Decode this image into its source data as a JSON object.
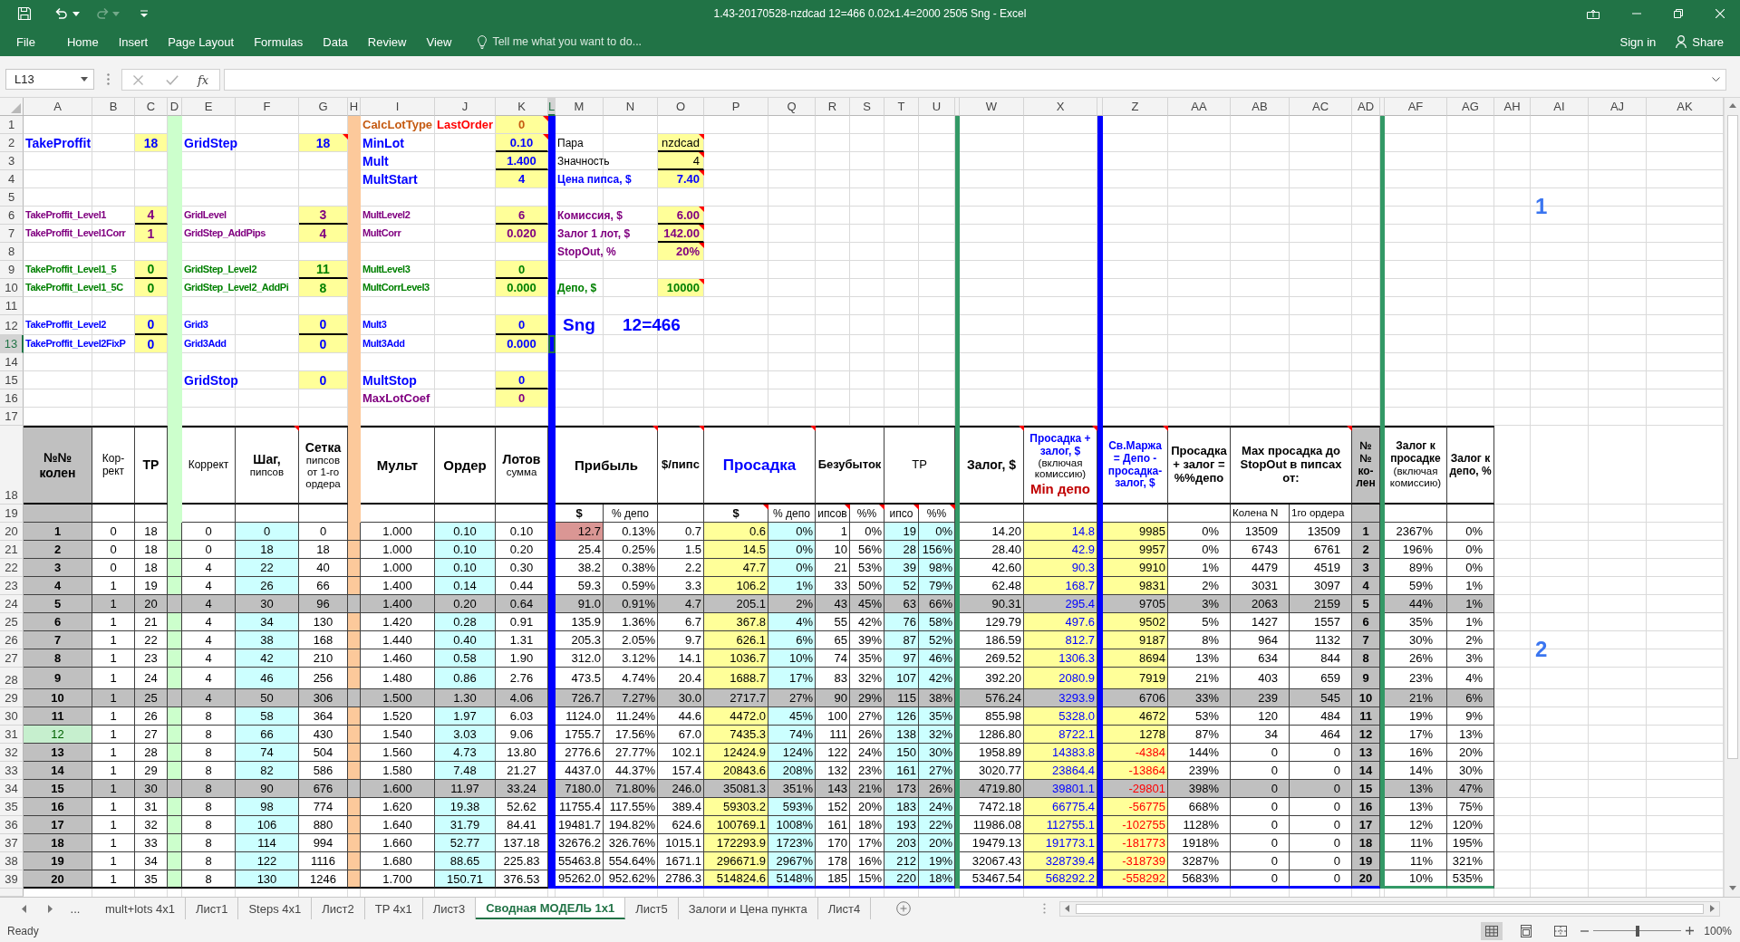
{
  "window": {
    "title": "1.43-20170528-nzdcad 12=466 0.02x1.4=2000 2505 Sng - Excel"
  },
  "quick_access": {
    "redo_disabled": true
  },
  "ribbon": {
    "tabs": [
      {
        "label": "File",
        "selected": false
      },
      {
        "label": "Home",
        "selected": false
      },
      {
        "label": "Insert",
        "selected": false
      },
      {
        "label": "Page Layout",
        "selected": false
      },
      {
        "label": "Formulas",
        "selected": false
      },
      {
        "label": "Data",
        "selected": false
      },
      {
        "label": "Review",
        "selected": false
      },
      {
        "label": "View",
        "selected": false
      }
    ],
    "tell_me": {
      "placeholder": "Tell me what you want to do..."
    },
    "sign_in": "Sign in",
    "share": "Share"
  },
  "formula_bar": {
    "name_box": "L13",
    "function_label": "fx",
    "edit_disabled": true
  },
  "columns": [
    {
      "label": "A",
      "selected": false
    },
    {
      "label": "B",
      "selected": false
    },
    {
      "label": "C",
      "selected": false
    },
    {
      "label": "D",
      "selected": false
    },
    {
      "label": "E",
      "selected": false
    },
    {
      "label": "F",
      "selected": false
    },
    {
      "label": "G",
      "selected": false
    },
    {
      "label": "H",
      "selected": false
    },
    {
      "label": "I",
      "selected": false
    },
    {
      "label": "J",
      "selected": false
    },
    {
      "label": "K",
      "selected": false
    },
    {
      "label": "L",
      "selected": true
    },
    {
      "label": "M",
      "selected": false
    },
    {
      "label": "N",
      "selected": false
    },
    {
      "label": "O",
      "selected": false
    },
    {
      "label": "P",
      "selected": false
    },
    {
      "label": "Q",
      "selected": false
    },
    {
      "label": "R",
      "selected": false
    },
    {
      "label": "S",
      "selected": false
    },
    {
      "label": "T",
      "selected": false
    },
    {
      "label": "U",
      "selected": false
    },
    {
      "selected": false
    },
    {
      "label": "W",
      "selected": false
    },
    {
      "label": "X",
      "selected": false
    },
    {
      "selected": false
    },
    {
      "label": "Z",
      "selected": false
    },
    {
      "label": "AA",
      "selected": false
    },
    {
      "label": "AB",
      "selected": false
    },
    {
      "label": "AC",
      "selected": false
    },
    {
      "label": "AD",
      "selected": false
    },
    {
      "selected": false
    },
    {
      "label": "AF",
      "selected": false
    },
    {
      "label": "AG",
      "selected": false
    },
    {
      "label": "AH",
      "selected": false
    },
    {
      "label": "AI",
      "selected": false
    },
    {
      "label": "AJ",
      "selected": false
    },
    {
      "label": "AK",
      "selected": false
    }
  ],
  "rows": [
    {
      "label": "1",
      "selected": false
    },
    {
      "label": "2",
      "selected": false
    },
    {
      "label": "3",
      "selected": false
    },
    {
      "label": "4",
      "selected": false
    },
    {
      "label": "5",
      "selected": false
    },
    {
      "label": "6",
      "selected": false
    },
    {
      "label": "7",
      "selected": false
    },
    {
      "label": "8",
      "selected": false
    },
    {
      "label": "9",
      "selected": false
    },
    {
      "label": "10",
      "selected": false
    },
    {
      "label": "11",
      "selected": false
    },
    {
      "label": "12",
      "selected": false
    },
    {
      "label": "13",
      "selected": true
    },
    {
      "label": "14",
      "selected": false
    },
    {
      "label": "15",
      "selected": false
    },
    {
      "label": "16",
      "selected": false
    },
    {
      "label": "17",
      "selected": false
    },
    {
      "label": "18",
      "selected": false
    },
    {
      "label": "19",
      "selected": false
    },
    {
      "label": "20",
      "selected": false
    },
    {
      "label": "21",
      "selected": false
    },
    {
      "label": "22",
      "selected": false
    },
    {
      "label": "23",
      "selected": false
    },
    {
      "label": "24",
      "selected": false
    },
    {
      "label": "25",
      "selected": false
    },
    {
      "label": "26",
      "selected": false
    },
    {
      "label": "27",
      "selected": false
    },
    {
      "label": "28",
      "selected": false
    },
    {
      "label": "29",
      "selected": false
    },
    {
      "label": "30",
      "selected": false
    },
    {
      "label": "31",
      "selected": false
    },
    {
      "label": "32",
      "selected": false
    },
    {
      "label": "33",
      "selected": false
    },
    {
      "label": "34",
      "selected": false
    },
    {
      "label": "35",
      "selected": false
    },
    {
      "label": "36",
      "selected": false
    },
    {
      "label": "37",
      "selected": false
    },
    {
      "label": "38",
      "selected": false
    },
    {
      "label": "39",
      "selected": false
    }
  ],
  "parameters": {
    "take_profit": [
      {
        "label": "TakeProffit",
        "value": "18",
        "kind": "main",
        "ruled": false,
        "comment": false
      },
      {
        "label": "TakeProffit_Level1",
        "value": "4",
        "kind": "level1",
        "ruled": true,
        "comment": false
      },
      {
        "label": "TakeProffit_Level1Corr",
        "value": "1",
        "kind": "level1",
        "ruled": false,
        "comment": false
      },
      {
        "label": "TakeProffit_Level1_5",
        "value": "0",
        "kind": "level15",
        "ruled": true,
        "comment": false
      },
      {
        "label": "TakeProffit_Level1_5C",
        "value": "0",
        "kind": "level15",
        "ruled": false,
        "comment": false
      },
      {
        "label": "TakeProffit_Level2",
        "value": "0",
        "kind": "level2",
        "ruled": true,
        "comment": false
      },
      {
        "label": "TakeProffit_Level2FixP",
        "value": "0",
        "kind": "level2",
        "ruled": false,
        "comment": false
      }
    ],
    "grid": [
      {
        "label": "GridStep",
        "value": "18",
        "kind": "main",
        "ruled": false,
        "comment": true
      },
      {
        "label": "GridLevel",
        "value": "3",
        "kind": "level1",
        "ruled": true,
        "comment": false
      },
      {
        "label": "GridStep_AddPips",
        "value": "4",
        "kind": "level1",
        "ruled": false,
        "comment": false
      },
      {
        "label": "GridStep_Level2",
        "value": "11",
        "kind": "level15",
        "ruled": true,
        "comment": false
      },
      {
        "label": "GridStep_Level2_AddPi",
        "value": "8",
        "kind": "level15",
        "ruled": false,
        "comment": false
      },
      {
        "label": "Grid3",
        "value": "0",
        "kind": "level2",
        "ruled": true,
        "comment": false
      },
      {
        "label": "Grid3Add",
        "value": "0",
        "kind": "level2",
        "ruled": false,
        "comment": false
      },
      {
        "label": "GridStop",
        "value": "0",
        "kind": "main",
        "ruled": false,
        "comment": false
      }
    ],
    "lots": [
      {
        "label": "CalcLotType",
        "mode": "LastOrder",
        "value": "0",
        "kind": "type",
        "ruled": false,
        "comment": true
      },
      {
        "label": "MinLot",
        "value": "0.10",
        "kind": "main",
        "ruled": true,
        "comment": true
      },
      {
        "label": "Mult",
        "value": "1.400",
        "kind": "main",
        "ruled": true,
        "comment": false
      },
      {
        "label": "MultStart",
        "value": "4",
        "kind": "main",
        "ruled": false,
        "comment": false
      },
      {
        "label": "MultLevel2",
        "value": "6",
        "kind": "level1",
        "ruled": true,
        "comment": false
      },
      {
        "label": "MultCorr",
        "value": "0.020",
        "kind": "level1",
        "ruled": false,
        "comment": false
      },
      {
        "label": "MultLevel3",
        "value": "0",
        "kind": "level15",
        "ruled": true,
        "comment": false
      },
      {
        "label": "MultCorrLevel3",
        "value": "0.000",
        "kind": "level15",
        "ruled": false,
        "comment": false
      },
      {
        "label": "Mult3",
        "value": "0",
        "kind": "level2",
        "ruled": true,
        "comment": false
      },
      {
        "label": "Mult3Add",
        "value": "0.000",
        "kind": "level2",
        "ruled": false,
        "comment": false
      },
      {
        "label": "MultStop",
        "value": "0",
        "kind": "main",
        "ruled": true,
        "comment": false
      },
      {
        "label": "MaxLotCoef",
        "value": "0",
        "kind": "limit",
        "ruled": false,
        "comment": false
      }
    ],
    "instrument": [
      {
        "label": "Пара",
        "value": "nzdcad",
        "kind": "plain",
        "ruled": true,
        "comment": true
      },
      {
        "label": "Значность",
        "value": "4",
        "kind": "plain",
        "ruled": true,
        "comment": true
      },
      {
        "label": "Цена пипса, $",
        "value": "7.40",
        "kind": "main",
        "ruled": false,
        "comment": true
      },
      {
        "label": "Комиссия, $",
        "value": "6.00",
        "kind": "level1",
        "ruled": true,
        "comment": true
      },
      {
        "label": "Залог 1 лот, $",
        "value": "142.00",
        "kind": "level1",
        "ruled": true,
        "comment": true
      },
      {
        "label": "StopOut, %",
        "value": "20%",
        "kind": "level1",
        "ruled": false,
        "comment": true
      },
      {
        "label": "Депо, $",
        "value": "10000",
        "kind": "level15",
        "ruled": false,
        "comment": true
      }
    ]
  },
  "notes": [
    "Sng",
    "12=466"
  ],
  "markers": [
    "1",
    "2"
  ],
  "table": {
    "headers": [
      {
        "text": "№№ колен",
        "comment": false
      },
      {
        "text": "Кор-рект",
        "comment": false
      },
      {
        "text": "TP",
        "comment": false
      },
      {
        "text": "Коррект",
        "comment": false
      },
      {
        "text": "**Шаг,** пипсов",
        "comment": true
      },
      {
        "text": "**Сетка** пипсов от 1-го ордера",
        "comment": false
      },
      {
        "text": "Мульт",
        "comment": false
      },
      {
        "text": "Ордер",
        "comment": false
      },
      {
        "text": "**Лотов** сумма",
        "comment": false
      },
      {
        "text": "Прибыль",
        "comment": true
      },
      {
        "text": "$/пипс",
        "comment": true
      },
      {
        "text": "Просадка",
        "comment": true
      },
      {
        "text": "Безубыток",
        "comment": false
      },
      {
        "text": "TP",
        "comment": false
      },
      {
        "text": "Залог, $",
        "comment": true
      },
      {
        "text": "**Просадка + залог, $** (включая комиссию)",
        "warning": "Min депо",
        "comment": true
      },
      {
        "text": "Св.Маржа = Депо - просадка-залог, $",
        "comment": true
      },
      {
        "text": "Просадка + залог = %%депо",
        "comment": false
      },
      {
        "text": "Max просадка до StopOut в пипсах от:",
        "comment": true
      },
      {
        "text": "№ № ко-лен",
        "comment": false
      },
      {
        "text": "**Залог к просадке** (включая комиссию)",
        "comment": false
      },
      {
        "text": "Залог к депо, %",
        "comment": false
      }
    ],
    "subheaders": [
      {
        "text": "$",
        "comment": false
      },
      {
        "text": "% депо",
        "comment": false
      },
      {
        "text": "$",
        "comment": true
      },
      {
        "text": "% депо",
        "comment": false
      },
      {
        "text": "ипсов",
        "comment": true
      },
      {
        "text": "%%",
        "comment": true
      },
      {
        "text": "ипсо",
        "comment": true
      },
      {
        "text": "%%",
        "comment": true
      },
      {
        "text": "Колена N",
        "comment": false
      },
      {
        "text": "1го ордера",
        "comment": false
      }
    ],
    "rows": [
      {
        "cells": [
          "1",
          "0",
          "18",
          "0",
          "0",
          "0",
          "1.000",
          "0.10",
          "0.10",
          "12.7",
          "0.13%",
          "0.7",
          "0.6",
          "0%",
          "1",
          "0%",
          "19",
          "0%",
          "14.20",
          "14.8",
          "9985",
          "0%",
          "13509",
          "13509",
          "1",
          "2367%",
          "0%"
        ],
        "highlighted": false,
        "knee_marked": false,
        "profit_alert": true,
        "free_margin_negative": false
      },
      {
        "cells": [
          "2",
          "0",
          "18",
          "0",
          "18",
          "18",
          "1.000",
          "0.10",
          "0.20",
          "25.4",
          "0.25%",
          "1.5",
          "14.5",
          "0%",
          "10",
          "56%",
          "28",
          "156%",
          "28.40",
          "42.9",
          "9957",
          "0%",
          "6743",
          "6761",
          "2",
          "196%",
          "0%"
        ],
        "highlighted": false,
        "knee_marked": false,
        "profit_alert": false,
        "free_margin_negative": false
      },
      {
        "cells": [
          "3",
          "0",
          "18",
          "4",
          "22",
          "40",
          "1.000",
          "0.10",
          "0.30",
          "38.2",
          "0.38%",
          "2.2",
          "47.7",
          "0%",
          "21",
          "53%",
          "39",
          "98%",
          "42.60",
          "90.3",
          "9910",
          "1%",
          "4479",
          "4519",
          "3",
          "89%",
          "0%"
        ],
        "highlighted": false,
        "knee_marked": false,
        "profit_alert": false,
        "free_margin_negative": false
      },
      {
        "cells": [
          "4",
          "1",
          "19",
          "4",
          "26",
          "66",
          "1.400",
          "0.14",
          "0.44",
          "59.3",
          "0.59%",
          "3.3",
          "106.2",
          "1%",
          "33",
          "50%",
          "52",
          "79%",
          "62.48",
          "168.7",
          "9831",
          "2%",
          "3031",
          "3097",
          "4",
          "59%",
          "1%"
        ],
        "highlighted": false,
        "knee_marked": false,
        "profit_alert": false,
        "free_margin_negative": false
      },
      {
        "cells": [
          "5",
          "1",
          "20",
          "4",
          "30",
          "96",
          "1.400",
          "0.20",
          "0.64",
          "91.0",
          "0.91%",
          "4.7",
          "205.1",
          "2%",
          "43",
          "45%",
          "63",
          "66%",
          "90.31",
          "295.4",
          "9705",
          "3%",
          "2063",
          "2159",
          "5",
          "44%",
          "1%"
        ],
        "highlighted": true,
        "knee_marked": false,
        "profit_alert": false,
        "free_margin_negative": false
      },
      {
        "cells": [
          "6",
          "1",
          "21",
          "4",
          "34",
          "130",
          "1.420",
          "0.28",
          "0.91",
          "135.9",
          "1.36%",
          "6.7",
          "367.8",
          "4%",
          "55",
          "42%",
          "76",
          "58%",
          "129.79",
          "497.6",
          "9502",
          "5%",
          "1427",
          "1557",
          "6",
          "35%",
          "1%"
        ],
        "highlighted": false,
        "knee_marked": false,
        "profit_alert": false,
        "free_margin_negative": false
      },
      {
        "cells": [
          "7",
          "1",
          "22",
          "4",
          "38",
          "168",
          "1.440",
          "0.40",
          "1.31",
          "205.3",
          "2.05%",
          "9.7",
          "626.1",
          "6%",
          "65",
          "39%",
          "87",
          "52%",
          "186.59",
          "812.7",
          "9187",
          "8%",
          "964",
          "1132",
          "7",
          "30%",
          "2%"
        ],
        "highlighted": false,
        "knee_marked": false,
        "profit_alert": false,
        "free_margin_negative": false
      },
      {
        "cells": [
          "8",
          "1",
          "23",
          "4",
          "42",
          "210",
          "1.460",
          "0.58",
          "1.90",
          "312.0",
          "3.12%",
          "14.1",
          "1036.7",
          "10%",
          "74",
          "35%",
          "97",
          "46%",
          "269.52",
          "1306.3",
          "8694",
          "13%",
          "634",
          "844",
          "8",
          "26%",
          "3%"
        ],
        "highlighted": false,
        "knee_marked": false,
        "profit_alert": false,
        "free_margin_negative": false
      },
      {
        "cells": [
          "9",
          "1",
          "24",
          "4",
          "46",
          "256",
          "1.480",
          "0.86",
          "2.76",
          "473.5",
          "4.74%",
          "20.4",
          "1688.7",
          "17%",
          "83",
          "32%",
          "107",
          "42%",
          "392.20",
          "2080.9",
          "7919",
          "21%",
          "403",
          "659",
          "9",
          "23%",
          "4%"
        ],
        "highlighted": false,
        "knee_marked": false,
        "profit_alert": false,
        "free_margin_negative": false
      },
      {
        "cells": [
          "10",
          "1",
          "25",
          "4",
          "50",
          "306",
          "1.500",
          "1.30",
          "4.06",
          "726.7",
          "7.27%",
          "30.0",
          "2717.7",
          "27%",
          "90",
          "29%",
          "115",
          "38%",
          "576.24",
          "3293.9",
          "6706",
          "33%",
          "239",
          "545",
          "10",
          "21%",
          "6%"
        ],
        "highlighted": true,
        "knee_marked": false,
        "profit_alert": false,
        "free_margin_negative": false
      },
      {
        "cells": [
          "11",
          "1",
          "26",
          "8",
          "58",
          "364",
          "1.520",
          "1.97",
          "6.03",
          "1124.0",
          "11.24%",
          "44.6",
          "4472.0",
          "45%",
          "100",
          "27%",
          "126",
          "35%",
          "855.98",
          "5328.0",
          "4672",
          "53%",
          "120",
          "484",
          "11",
          "19%",
          "9%"
        ],
        "highlighted": false,
        "knee_marked": false,
        "profit_alert": false,
        "free_margin_negative": false
      },
      {
        "cells": [
          "12",
          "1",
          "27",
          "8",
          "66",
          "430",
          "1.540",
          "3.03",
          "9.06",
          "1755.7",
          "17.56%",
          "67.0",
          "7435.3",
          "74%",
          "111",
          "26%",
          "138",
          "32%",
          "1286.80",
          "8722.1",
          "1278",
          "87%",
          "34",
          "464",
          "12",
          "17%",
          "13%"
        ],
        "highlighted": false,
        "knee_marked": true,
        "profit_alert": false,
        "free_margin_negative": false
      },
      {
        "cells": [
          "13",
          "1",
          "28",
          "8",
          "74",
          "504",
          "1.560",
          "4.73",
          "13.80",
          "2776.6",
          "27.77%",
          "102.1",
          "12424.9",
          "124%",
          "122",
          "24%",
          "150",
          "30%",
          "1958.89",
          "14383.8",
          "-4384",
          "144%",
          "0",
          "0",
          "13",
          "16%",
          "20%"
        ],
        "highlighted": false,
        "knee_marked": false,
        "profit_alert": false,
        "free_margin_negative": true
      },
      {
        "cells": [
          "14",
          "1",
          "29",
          "8",
          "82",
          "586",
          "1.580",
          "7.48",
          "21.27",
          "4437.0",
          "44.37%",
          "157.4",
          "20843.6",
          "208%",
          "132",
          "23%",
          "161",
          "27%",
          "3020.77",
          "23864.4",
          "-13864",
          "239%",
          "0",
          "0",
          "14",
          "14%",
          "30%"
        ],
        "highlighted": false,
        "knee_marked": false,
        "profit_alert": false,
        "free_margin_negative": true
      },
      {
        "cells": [
          "15",
          "1",
          "30",
          "8",
          "90",
          "676",
          "1.600",
          "11.97",
          "33.24",
          "7180.0",
          "71.80%",
          "246.0",
          "35081.3",
          "351%",
          "143",
          "21%",
          "173",
          "26%",
          "4719.80",
          "39801.1",
          "-29801",
          "398%",
          "0",
          "0",
          "15",
          "13%",
          "47%"
        ],
        "highlighted": true,
        "knee_marked": false,
        "profit_alert": false,
        "free_margin_negative": true
      },
      {
        "cells": [
          "16",
          "1",
          "31",
          "8",
          "98",
          "774",
          "1.620",
          "19.38",
          "52.62",
          "11755.4",
          "117.55%",
          "389.4",
          "59303.2",
          "593%",
          "152",
          "20%",
          "183",
          "24%",
          "7472.18",
          "66775.4",
          "-56775",
          "668%",
          "0",
          "0",
          "16",
          "13%",
          "75%"
        ],
        "highlighted": false,
        "knee_marked": false,
        "profit_alert": false,
        "free_margin_negative": true
      },
      {
        "cells": [
          "17",
          "1",
          "32",
          "8",
          "106",
          "880",
          "1.640",
          "31.79",
          "84.41",
          "19481.7",
          "194.82%",
          "624.6",
          "100769.1",
          "1008%",
          "161",
          "18%",
          "193",
          "22%",
          "11986.08",
          "112755.1",
          "-102755",
          "1128%",
          "0",
          "0",
          "17",
          "12%",
          "120%"
        ],
        "highlighted": false,
        "knee_marked": false,
        "profit_alert": false,
        "free_margin_negative": true
      },
      {
        "cells": [
          "18",
          "1",
          "33",
          "8",
          "114",
          "994",
          "1.660",
          "52.77",
          "137.18",
          "32676.2",
          "326.76%",
          "1015.1",
          "172293.9",
          "1723%",
          "170",
          "17%",
          "203",
          "20%",
          "19479.13",
          "191773.1",
          "-181773",
          "1918%",
          "0",
          "0",
          "18",
          "11%",
          "195%"
        ],
        "highlighted": false,
        "knee_marked": false,
        "profit_alert": false,
        "free_margin_negative": true
      },
      {
        "cells": [
          "19",
          "1",
          "34",
          "8",
          "122",
          "1116",
          "1.680",
          "88.65",
          "225.83",
          "55463.8",
          "554.64%",
          "1671.1",
          "296671.9",
          "2967%",
          "178",
          "16%",
          "212",
          "19%",
          "32067.43",
          "328739.4",
          "-318739",
          "3287%",
          "0",
          "0",
          "19",
          "11%",
          "321%"
        ],
        "highlighted": false,
        "knee_marked": false,
        "profit_alert": false,
        "free_margin_negative": true
      },
      {
        "cells": [
          "20",
          "1",
          "35",
          "8",
          "130",
          "1246",
          "1.700",
          "150.71",
          "376.53",
          "95262.0",
          "952.62%",
          "2786.3",
          "514824.6",
          "5148%",
          "185",
          "15%",
          "220",
          "18%",
          "53467.54",
          "568292.2",
          "-558292",
          "5683%",
          "0",
          "0",
          "20",
          "10%",
          "535%"
        ],
        "highlighted": false,
        "knee_marked": false,
        "profit_alert": false,
        "free_margin_negative": true
      }
    ]
  },
  "sheet_tabs": {
    "more": "...",
    "tabs": [
      {
        "label": "mult+lots 4x1",
        "selected": false
      },
      {
        "label": "Лист1",
        "selected": false
      },
      {
        "label": "Steps 4x1",
        "selected": false
      },
      {
        "label": "Лист2",
        "selected": false
      },
      {
        "label": "TP 4x1",
        "selected": false
      },
      {
        "label": "Лист3",
        "selected": false
      },
      {
        "label": "Сводная МОДЕЛЬ 1x1",
        "selected": true
      },
      {
        "label": "Лист5",
        "selected": false
      },
      {
        "label": "Залоги и Цена пункта",
        "selected": false
      },
      {
        "label": "Лист4",
        "selected": false
      }
    ]
  },
  "status_bar": {
    "status": "Ready",
    "views": [
      {
        "kind": "normal",
        "selected": true
      },
      {
        "kind": "page_layout",
        "selected": false
      },
      {
        "kind": "page_break",
        "selected": false
      }
    ],
    "zoom": {
      "level": 0.5,
      "reading": "100%"
    }
  }
}
